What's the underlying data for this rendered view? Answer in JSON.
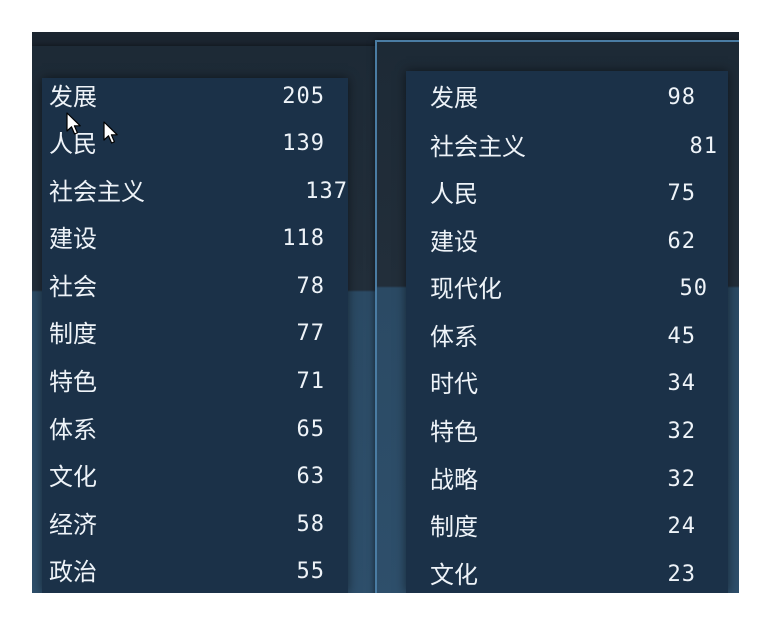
{
  "left_list": {
    "items": [
      {
        "term": "发展",
        "count": "205"
      },
      {
        "term": "人民",
        "count": "139"
      },
      {
        "term": "社会主义",
        "count": "137"
      },
      {
        "term": "建设",
        "count": "118"
      },
      {
        "term": "社会",
        "count": "78"
      },
      {
        "term": "制度",
        "count": "77"
      },
      {
        "term": "特色",
        "count": "71"
      },
      {
        "term": "体系",
        "count": "65"
      },
      {
        "term": "文化",
        "count": "63"
      },
      {
        "term": "经济",
        "count": "58"
      },
      {
        "term": "政治",
        "count": "55"
      }
    ]
  },
  "right_list": {
    "items": [
      {
        "term": "发展",
        "count": "98"
      },
      {
        "term": "社会主义",
        "count": "81"
      },
      {
        "term": "人民",
        "count": "75"
      },
      {
        "term": "建设",
        "count": "62"
      },
      {
        "term": "现代化",
        "count": "50"
      },
      {
        "term": "体系",
        "count": "45"
      },
      {
        "term": "时代",
        "count": "34"
      },
      {
        "term": "特色",
        "count": "32"
      },
      {
        "term": "战略",
        "count": "32"
      },
      {
        "term": "制度",
        "count": "24"
      },
      {
        "term": "文化",
        "count": "23"
      }
    ]
  },
  "colors": {
    "panel_dark": "#1b2530",
    "list_background": "#1b3148",
    "text": "#eef3f8",
    "panel_border": "#4a7ca3"
  },
  "icons": [
    "mouse-pointer-icon",
    "mouse-pointer-icon"
  ]
}
